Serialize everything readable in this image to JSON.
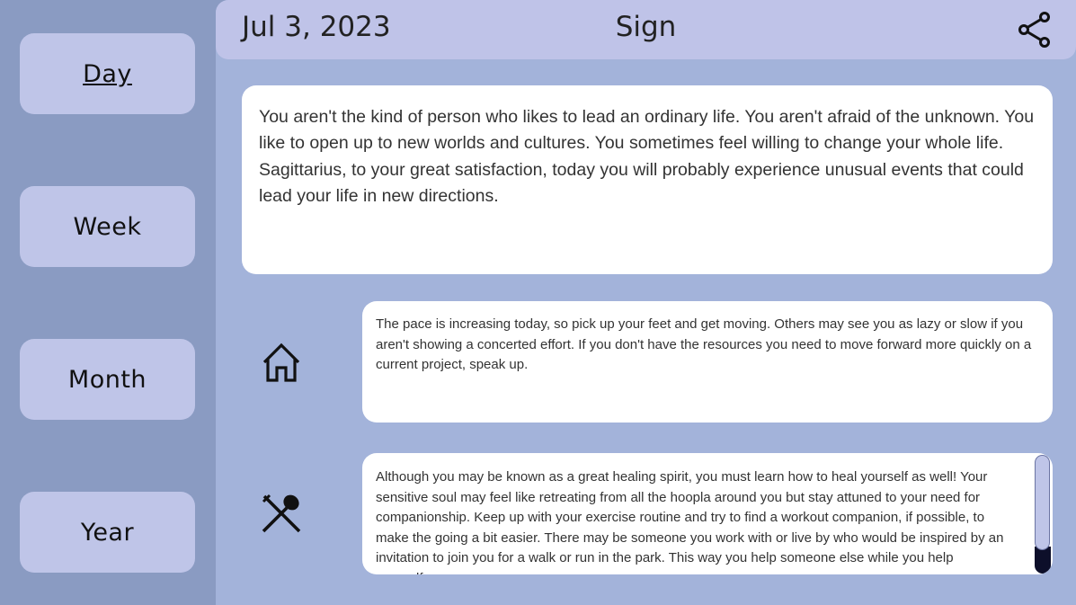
{
  "sidebar": {
    "items": [
      {
        "label": "Day",
        "active": true
      },
      {
        "label": "Week",
        "active": false
      },
      {
        "label": "Month",
        "active": false
      },
      {
        "label": "Year",
        "active": false
      }
    ]
  },
  "header": {
    "date": "Jul 3, 2023",
    "title": "Sign",
    "share_icon": "share-icon"
  },
  "main_card": {
    "text": "You aren't the kind of person who likes to lead an ordinary life. You aren't afraid of the unknown. You like to open up to new worlds and cultures. You sometimes feel willing to change your whole life. Sagittarius, to your great satisfaction, today you will probably experience unusual events that could lead your life in new directions."
  },
  "sections": [
    {
      "icon": "home-icon",
      "text": "The pace is increasing today, so pick up your feet and get moving. Others may see you as lazy or slow if you aren't showing a concerted effort. If you don't have the resources you need to move forward more quickly on a current project, speak up."
    },
    {
      "icon": "fork-spoon-icon",
      "text": "Although you may be known as a great healing spirit, you must learn how to heal yourself as well! Your sensitive soul may feel like retreating from all the hoopla around you but stay attuned to your need for companionship. Keep up with your exercise routine and try to find a workout companion, if possible, to make the going a bit easier. There may be someone you work with or live by who would be inspired by an invitation to join you for a walk or run in the park. This way you help someone else while you help yourself."
    }
  ],
  "colors": {
    "sidebar_bg": "#8a9bc2",
    "main_bg": "#a3b3da",
    "header_bg": "#bfc3e8",
    "button_bg": "#bfc5e8",
    "card_bg": "#ffffff"
  }
}
